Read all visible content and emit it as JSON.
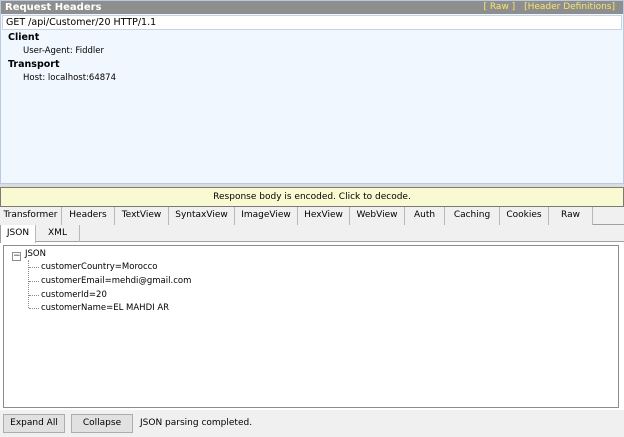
{
  "request": {
    "title": "Request Headers",
    "links": [
      "[ Raw ]",
      "[Header Definitions]"
    ],
    "request_line": "GET /api/Customer/20 HTTP/1.1",
    "groups": [
      {
        "name": "Client",
        "headers": [
          "User-Agent: Fiddler"
        ]
      },
      {
        "name": "Transport",
        "headers": [
          "Host: localhost:64874"
        ]
      }
    ]
  },
  "decode_bar": "Response body is encoded. Click to decode.",
  "tabs": [
    "Transformer",
    "Headers",
    "TextView",
    "SyntaxView",
    "ImageView",
    "HexView",
    "WebView",
    "Auth",
    "Caching",
    "Cookies",
    "Raw"
  ],
  "subtabs": [
    "JSON",
    "XML"
  ],
  "tree": {
    "expander": "−",
    "root": "JSON",
    "nodes": [
      "customerCountry=Morocco",
      "customerEmail=mehdi@gmail.com",
      "customerId=20",
      "customerName=EL MAHDI AR"
    ]
  },
  "bottom": {
    "expand_all": "Expand All",
    "collapse": "Collapse",
    "status": "JSON parsing completed."
  }
}
